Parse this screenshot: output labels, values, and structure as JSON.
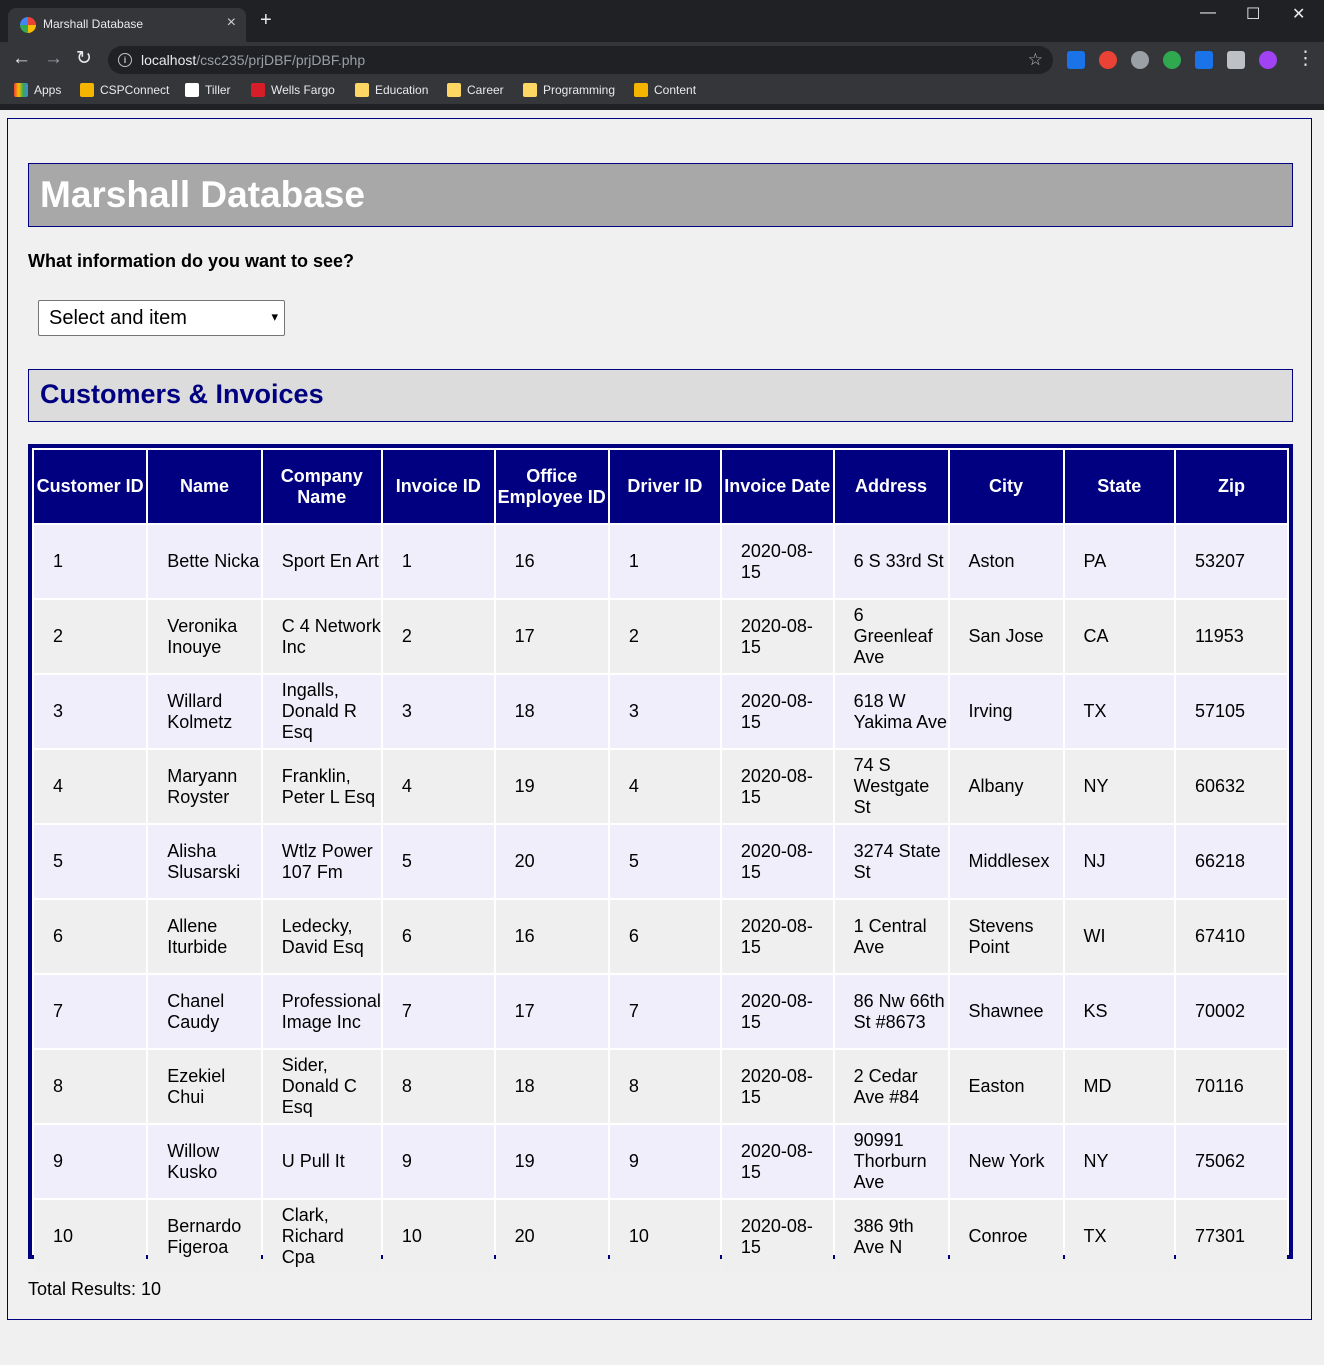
{
  "browser": {
    "tab_title": "Marshall Database",
    "new_tab": "+",
    "url_host": "localhost",
    "url_path": "/csc235/prjDBF/prjDBF.php",
    "bookmarks": [
      "Apps",
      "CSPConnect",
      "Tiller",
      "Wells Fargo",
      "Education",
      "Career",
      "Programming",
      "Content"
    ]
  },
  "page": {
    "title": "Marshall Database",
    "question": "What information do you want to see?",
    "select": {
      "value": "Select and item"
    },
    "section_title": "Customers & Invoices",
    "total": "Total Results: 10"
  },
  "table": {
    "headers": [
      "Customer ID",
      "Name",
      "Company Name",
      "Invoice ID",
      "Office Employee ID",
      "Driver ID",
      "Invoice Date",
      "Address",
      "City",
      "State",
      "Zip"
    ],
    "rows": [
      [
        "1",
        "Bette Nicka",
        "Sport En Art",
        "1",
        "16",
        "1",
        "2020-08-15",
        "6 S 33rd St",
        "Aston",
        "PA",
        "53207"
      ],
      [
        "2",
        "Veronika Inouye",
        "C 4 Network Inc",
        "2",
        "17",
        "2",
        "2020-08-15",
        "6 Greenleaf Ave",
        "San Jose",
        "CA",
        "11953"
      ],
      [
        "3",
        "Willard Kolmetz",
        "Ingalls, Donald R Esq",
        "3",
        "18",
        "3",
        "2020-08-15",
        "618 W Yakima Ave",
        "Irving",
        "TX",
        "57105"
      ],
      [
        "4",
        "Maryann Royster",
        "Franklin, Peter L Esq",
        "4",
        "19",
        "4",
        "2020-08-15",
        "74 S Westgate St",
        "Albany",
        "NY",
        "60632"
      ],
      [
        "5",
        "Alisha Slusarski",
        "Wtlz Power 107 Fm",
        "5",
        "20",
        "5",
        "2020-08-15",
        "3274 State St",
        "Middlesex",
        "NJ",
        "66218"
      ],
      [
        "6",
        "Allene Iturbide",
        "Ledecky, David Esq",
        "6",
        "16",
        "6",
        "2020-08-15",
        "1 Central Ave",
        "Stevens Point",
        "WI",
        "67410"
      ],
      [
        "7",
        "Chanel Caudy",
        "Professional Image Inc",
        "7",
        "17",
        "7",
        "2020-08-15",
        "86 Nw 66th St #8673",
        "Shawnee",
        "KS",
        "70002"
      ],
      [
        "8",
        "Ezekiel Chui",
        "Sider, Donald C Esq",
        "8",
        "18",
        "8",
        "2020-08-15",
        "2 Cedar Ave #84",
        "Easton",
        "MD",
        "70116"
      ],
      [
        "9",
        "Willow Kusko",
        "U Pull It",
        "9",
        "19",
        "9",
        "2020-08-15",
        "90991 Thorburn Ave",
        "New York",
        "NY",
        "75062"
      ],
      [
        "10",
        "Bernardo Figeroa",
        "Clark, Richard Cpa",
        "10",
        "20",
        "10",
        "2020-08-15",
        "386 9th Ave N",
        "Conroe",
        "TX",
        "77301"
      ]
    ]
  },
  "colors": {
    "navy": "#000080",
    "banner_gray": "#a8a8a8",
    "row_lavender": "#f1eefc",
    "row_gray": "#efefef"
  }
}
